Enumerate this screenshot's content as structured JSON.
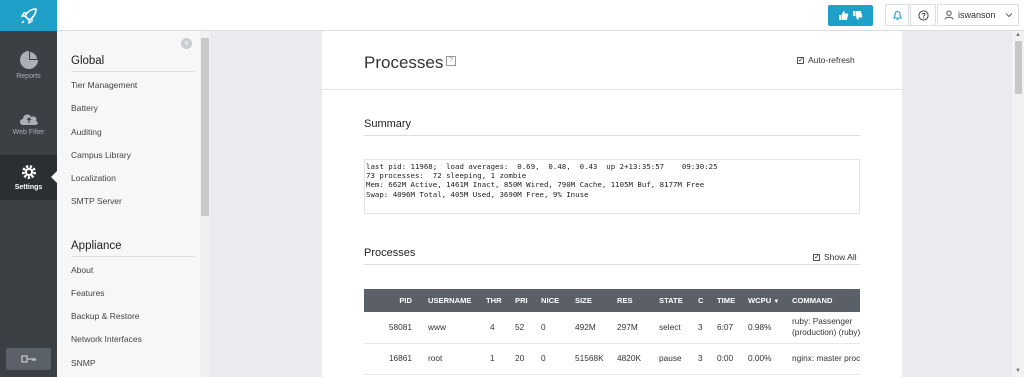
{
  "rail": {
    "items": [
      {
        "label": "Reports",
        "icon": "pie-chart-icon"
      },
      {
        "label": "Web Filter",
        "icon": "cloud-icon"
      },
      {
        "label": "Settings",
        "icon": "gear-icon",
        "active": true
      }
    ]
  },
  "topbar": {
    "username": "iswanson"
  },
  "sidebar": {
    "global_title": "Global",
    "global_items": [
      "Tier Management",
      "Battery",
      "Auditing",
      "Campus Library",
      "Localization",
      "SMTP Server"
    ],
    "appliance_title": "Appliance",
    "appliance_items": [
      "About",
      "Features",
      "Backup & Restore",
      "Network Interfaces",
      "SNMP"
    ]
  },
  "main": {
    "title": "Processes",
    "autorefresh_label": "Auto-refresh",
    "summary_title": "Summary",
    "summary_lines": [
      "last pid: 11968;  load averages:  0.69,  0.48,  0.43  up 2+13:35:57    09:30:25",
      "73 processes:  72 sleeping, 1 zombie",
      "",
      "Mem: 662M Active, 1461M Inact, 850M Wired, 790M Cache, 1105M Buf, 8177M Free",
      "Swap: 4096M Total, 405M Used, 3690M Free, 9% Inuse"
    ],
    "processes_title": "Processes",
    "showall_label": "Show All",
    "columns": [
      "PID",
      "USERNAME",
      "THR",
      "PRI",
      "NICE",
      "SIZE",
      "RES",
      "STATE",
      "C",
      "TIME",
      "WCPU",
      "COMMAND"
    ],
    "rows": [
      {
        "pid": "58081",
        "username": "www",
        "thr": "4",
        "pri": "52",
        "nice": "0",
        "size": "492M",
        "res": "297M",
        "state": "select",
        "c": "3",
        "time": "6:07",
        "wcpu": "0.98%",
        "command": "ruby: Passenger (production) (ruby)"
      },
      {
        "pid": "16861",
        "username": "root",
        "thr": "1",
        "pri": "20",
        "nice": "0",
        "size": "51568K",
        "res": "4820K",
        "state": "pause",
        "c": "3",
        "time": "0:00",
        "wcpu": "0.00%",
        "command": "nginx: master process"
      }
    ]
  },
  "colors": {
    "brand": "#1ea0c8",
    "rail": "#3b4045",
    "table_header": "#5b6068"
  }
}
